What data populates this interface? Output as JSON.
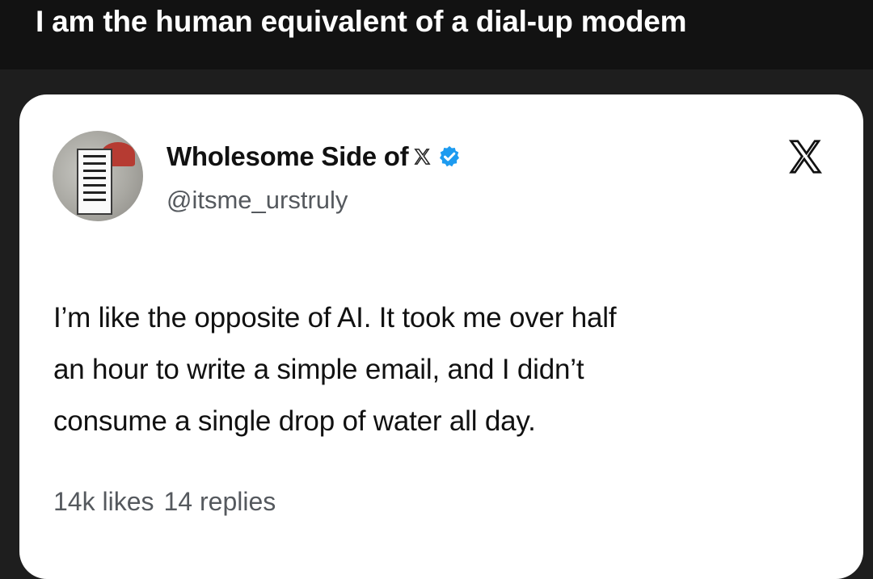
{
  "caption": "I am the human equivalent of a dial-up modem",
  "tweet": {
    "display_name": "Wholesome Side of",
    "handle": "@itsme_urstruly",
    "text_lines": [
      "I’m like the opposite of AI. It took me over half",
      "an hour to write a simple email, and I didn’t",
      "consume a single drop of water all day."
    ],
    "likes": "14k likes",
    "replies": "14 replies"
  },
  "colors": {
    "page_background": "#1e1e1e",
    "card_background": "#ffffff",
    "verified_badge": "#1d9bf0",
    "secondary_text": "#55595e"
  },
  "icons": {
    "platform_logo": "x-logo-icon",
    "verified": "verified-badge-icon"
  }
}
